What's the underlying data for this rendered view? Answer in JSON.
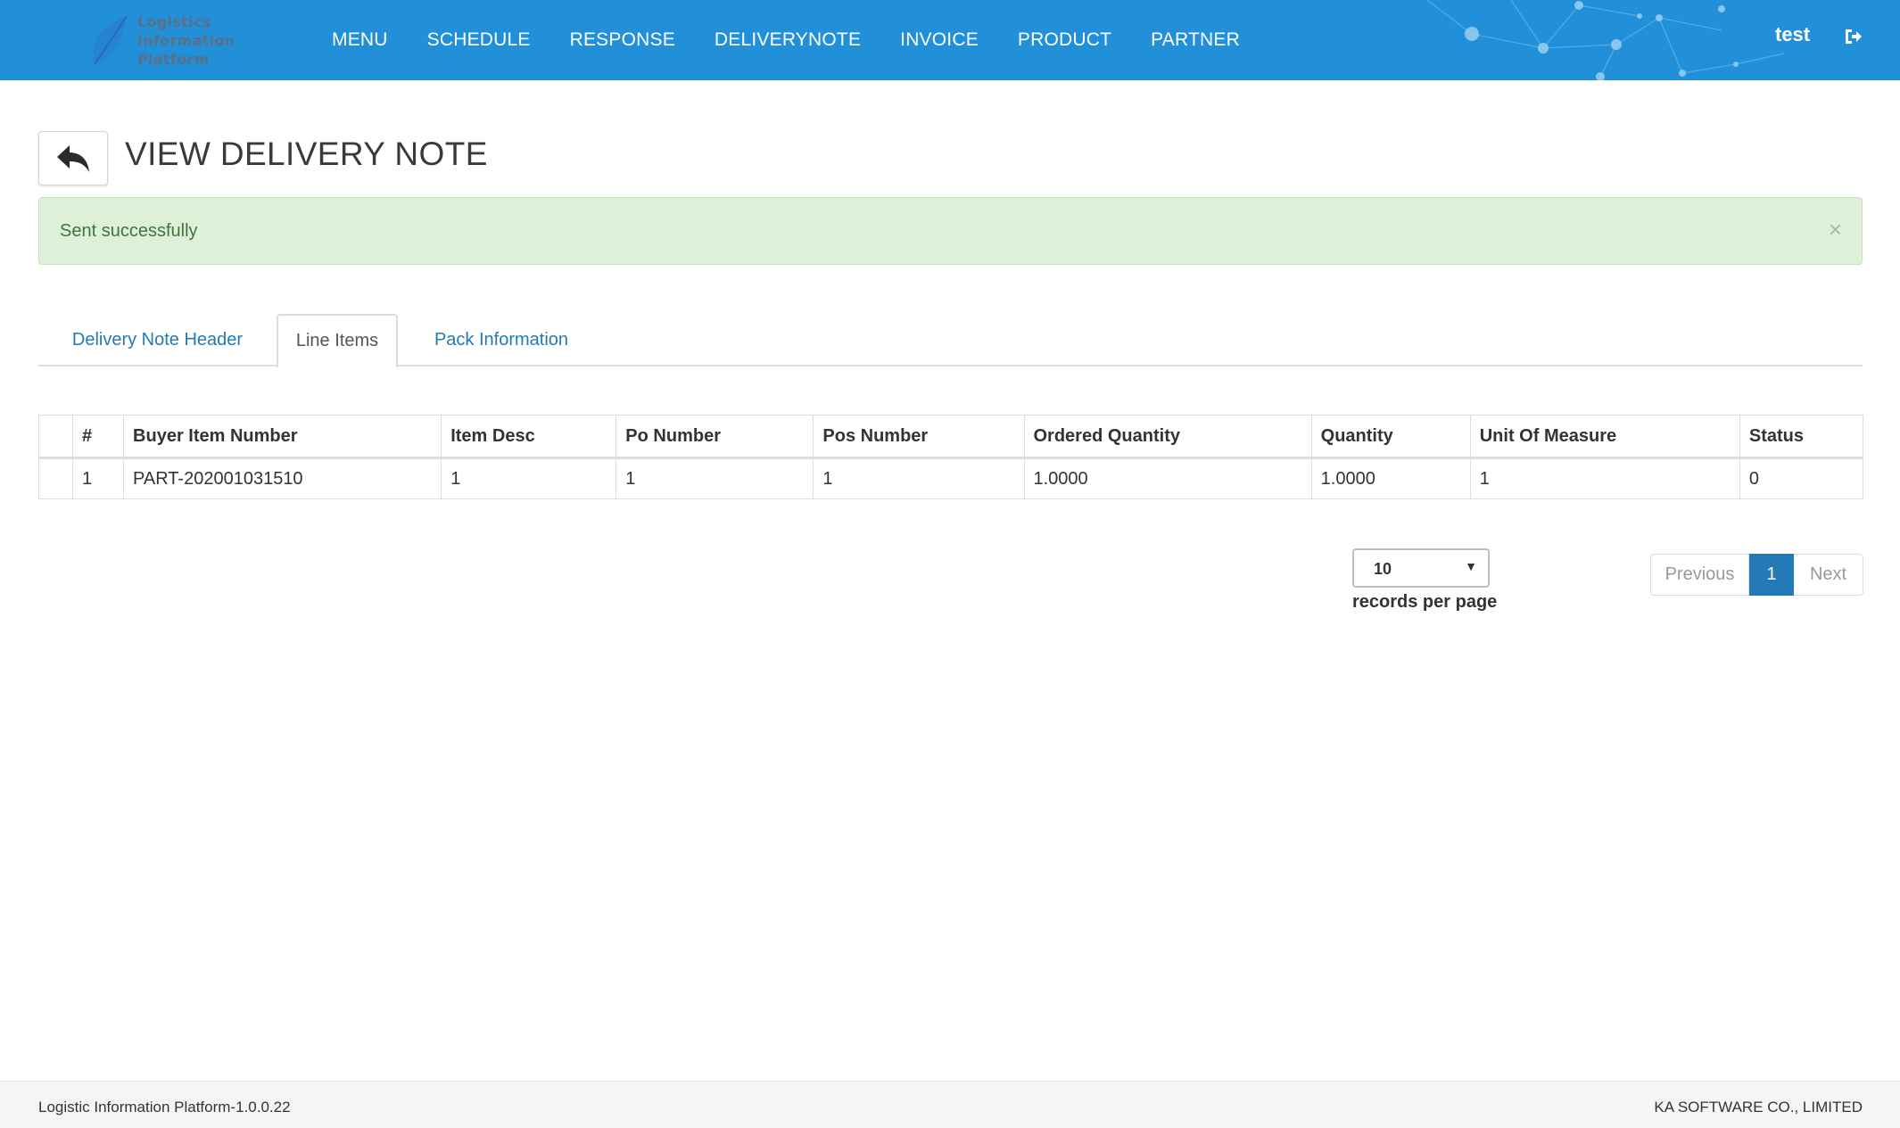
{
  "brand": {
    "line1": "Logistics",
    "line2": "Information",
    "line3": "Platform"
  },
  "nav": {
    "items": [
      "MENU",
      "SCHEDULE",
      "RESPONSE",
      "DELIVERYNOTE",
      "INVOICE",
      "PRODUCT",
      "PARTNER"
    ],
    "user": "test",
    "logout_icon": "sign-out-icon"
  },
  "page": {
    "title": "VIEW DELIVERY NOTE",
    "back_icon": "reply-arrow-icon"
  },
  "alert": {
    "message": "Sent successfully",
    "close": "×"
  },
  "tabs": [
    {
      "label": "Delivery Note Header",
      "active": false
    },
    {
      "label": "Line Items",
      "active": true
    },
    {
      "label": "Pack Information",
      "active": false
    }
  ],
  "table": {
    "headers": [
      "",
      "#",
      "Buyer Item Number",
      "Item Desc",
      "Po Number",
      "Pos Number",
      "Ordered Quantity",
      "Quantity",
      "Unit Of Measure",
      "Status"
    ],
    "rows": [
      [
        "",
        "1",
        "PART-202001031510",
        "1",
        "1",
        "1",
        "1.0000",
        "1.0000",
        "1",
        "0"
      ]
    ]
  },
  "pagination": {
    "page_size": "10",
    "page_size_caret": "▼",
    "records_label": "records per page",
    "previous": "Previous",
    "current": "1",
    "next": "Next"
  },
  "footer": {
    "left": "Logistic Information Platform-1.0.0.22",
    "right": "KA SOFTWARE CO., LIMITED"
  },
  "colors": {
    "navbar": "#2190d8",
    "link": "#2479b7",
    "alert_bg": "#dff0d8",
    "alert_text": "#3c763d"
  }
}
